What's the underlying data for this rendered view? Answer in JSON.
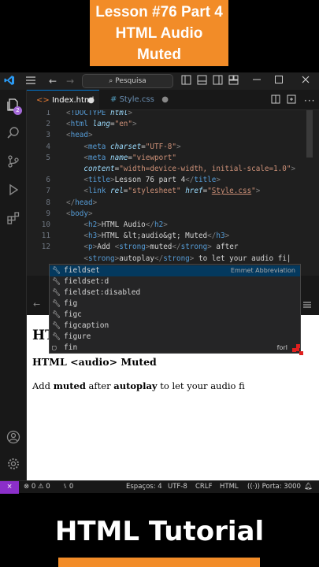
{
  "banner": {
    "line1": "Lesson #76 Part 4",
    "line2": "HTML Audio",
    "line3": "Muted"
  },
  "titlebar": {
    "search_label": "Pesquisa",
    "back_arrow": "←",
    "forward_arrow": "→"
  },
  "activity_bar": {
    "source_control_badge": "2"
  },
  "tabs": [
    {
      "label": "Index.html"
    },
    {
      "label": "Style.css"
    }
  ],
  "editor": {
    "lines": [
      {
        "n": "1",
        "html": "<span class='p'>&lt;</span><span class='t'>!DOCTYPE</span> <span class='a i'>html</span><span class='p'>&gt;</span>"
      },
      {
        "n": "2",
        "html": "<span class='p'>&lt;</span><span class='t'>html</span> <span class='a i'>lang</span><span class='x'>=</span><span class='s'>\"en\"</span><span class='p'>&gt;</span>"
      },
      {
        "n": "3",
        "html": "<span class='p'>&lt;</span><span class='t'>head</span><span class='p'>&gt;</span>"
      },
      {
        "n": "4",
        "html": "    <span class='p'>&lt;</span><span class='t'>meta</span> <span class='a i'>charset</span><span class='x'>=</span><span class='s'>\"UTF-8\"</span><span class='p'>&gt;</span>"
      },
      {
        "n": "5",
        "html": "    <span class='p'>&lt;</span><span class='t'>meta</span> <span class='a i'>name</span><span class='x'>=</span><span class='s'>\"viewport\"</span>"
      },
      {
        "n": "",
        "html": "    <span class='a i'>content</span><span class='x'>=</span><span class='s'>\"width=device-width, initial-scale=1.0\"</span><span class='p'>&gt;</span>"
      },
      {
        "n": "6",
        "html": "    <span class='p'>&lt;</span><span class='t'>title</span><span class='p'>&gt;</span><span class='x'>Lesson 76 part 4</span><span class='p'>&lt;/</span><span class='t'>title</span><span class='p'>&gt;</span>"
      },
      {
        "n": "7",
        "html": "    <span class='p'>&lt;</span><span class='t'>link</span> <span class='a i'>rel</span><span class='x'>=</span><span class='s'>\"stylesheet\"</span> <span class='a i'>href</span><span class='x'>=</span><span class='s'>\"<u>Style.css</u>\"</span><span class='p'>&gt;</span>"
      },
      {
        "n": "8",
        "html": "<span class='p'>&lt;/</span><span class='t'>head</span><span class='p'>&gt;</span>"
      },
      {
        "n": "9",
        "html": "<span class='p'>&lt;</span><span class='t'>body</span><span class='p'>&gt;</span>"
      },
      {
        "n": "10",
        "html": "    <span class='p'>&lt;</span><span class='t'>h2</span><span class='p'>&gt;</span><span class='x'>HTML Audio</span><span class='p'>&lt;/</span><span class='t'>h2</span><span class='p'>&gt;</span>"
      },
      {
        "n": "11",
        "html": "    <span class='p'>&lt;</span><span class='t'>h3</span><span class='p'>&gt;</span><span class='x'>HTML &amp;lt;audio&amp;gt; Muted</span><span class='p'>&lt;/</span><span class='t'>h3</span><span class='p'>&gt;</span>"
      },
      {
        "n": "12",
        "html": "    <span class='p'>&lt;</span><span class='t'>p</span><span class='p'>&gt;</span><span class='x'>Add </span><span class='p'>&lt;</span><span class='t'>strong</span><span class='p'>&gt;</span><span class='x'>muted</span><span class='p'>&lt;/</span><span class='t'>strong</span><span class='p'>&gt;</span><span class='x'> after</span>"
      },
      {
        "n": "",
        "html": "    <span class='p'>&lt;</span><span class='t'>strong</span><span class='p'>&gt;</span><span class='x'>autoplay</span><span class='p'>&lt;/</span><span class='t'>strong</span><span class='p'>&gt;</span><span class='x'> to let your audio fi|</span>"
      }
    ]
  },
  "autocomplete": {
    "hint": "Emmet Abbreviation",
    "items": [
      "fieldset",
      "fieldset:d",
      "fieldset:disabled",
      "fig",
      "figc",
      "figcaption",
      "figure",
      "fin"
    ],
    "right_hint": "forI"
  },
  "preview": {
    "h2": "HTML Audio",
    "h3": "HTML <audio> Muted",
    "p_before": "Add ",
    "p_strong1": "muted",
    "p_middle": " after ",
    "p_strong2": "autoplay",
    "p_after": " to let your audio fi"
  },
  "status_bar": {
    "errors": "0",
    "warnings": "0",
    "ports_count": "0",
    "spaces": "Espaços: 4",
    "encoding": "UTF-8",
    "eol": "CRLF",
    "language": "HTML",
    "port": "Porta: 3000"
  },
  "footer": {
    "title": "HTML Tutorial"
  },
  "colors": {
    "accent_orange": "#f28c28",
    "vscode_blue": "#0078d4",
    "remote_purple": "#8b2fc9"
  }
}
